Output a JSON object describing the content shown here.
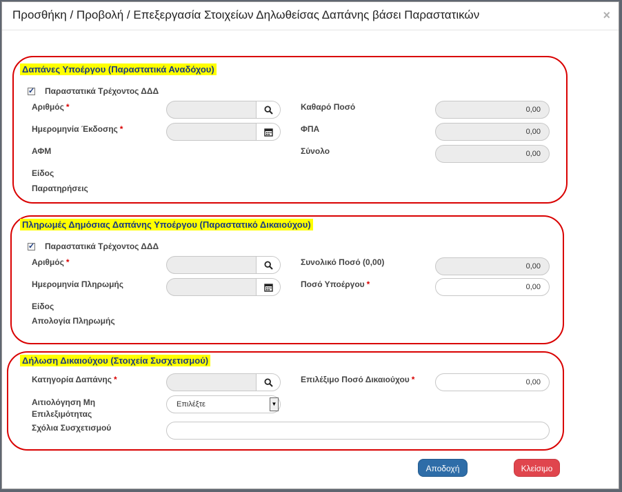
{
  "modal": {
    "title": "Προσθήκη / Προβολή / Επεξεργασία Στοιχείων Δηλωθείσας Δαπάνης βάσει Παραστατικών",
    "close_symbol": "×"
  },
  "section1": {
    "title": "Δαπάνες Υποέργου (Παραστατικά Αναδόχου)",
    "checkbox_label": "Παραστατικά Τρέχοντος ΔΔΔ",
    "arithmos_label": "Αριθμός",
    "hm_ekdosis_label": "Ημερομηνία Έκδοσης",
    "afm_label": "ΑΦΜ",
    "eidos_label": "Είδος",
    "paratiriseis_label": "Παρατηρήσεις",
    "katharo_label": "Καθαρό Ποσό",
    "katharo_value": "0,00",
    "fpa_label": "ΦΠΑ",
    "fpa_value": "0,00",
    "synolo_label": "Σύνολο",
    "synolo_value": "0,00"
  },
  "section2": {
    "title": "Πληρωμές Δημόσιας Δαπάνης Υποέργου (Παραστατικό Δικαιούχου)",
    "checkbox_label": "Παραστατικά Τρέχοντος ΔΔΔ",
    "arithmos_label": "Αριθμός",
    "hm_pliromis_label": "Ημερομηνία Πληρωμής",
    "eidos_label": "Είδος",
    "apologia_label": "Απολογία Πληρωμής",
    "synoliko_label": "Συνολικό Ποσό (0,00)",
    "synoliko_value": "0,00",
    "poso_label": "Ποσό Υποέργου",
    "poso_value": "0,00"
  },
  "section3": {
    "title": "Δήλωση Δικαιούχου (Στοιχεία Συσχετισμού)",
    "kategoria_label": "Κατηγορία Δαπάνης",
    "aitiologisi_line1": "Αιτιολόγηση Μη",
    "aitiologisi_line2": "Επιλεξιμότητας",
    "select_value": "Επιλέξτε",
    "sxolia_label": "Σχόλια Συσχετισμού",
    "epilexomo_label": "Επιλέξιμο Ποσό Δικαιούχου",
    "epilexomo_value": "0,00"
  },
  "required_mark": "*",
  "buttons": {
    "accept": "Αποδοχή",
    "close": "Κλείσιμο"
  },
  "icons": {
    "search": "search-icon",
    "calendar": "calendar-icon",
    "dropdown": "dropdown-arrow-icon"
  },
  "colors": {
    "highlight": "#ffff00",
    "section_border": "#d90000",
    "primary": "#2e6da8",
    "danger": "#e0454d"
  }
}
